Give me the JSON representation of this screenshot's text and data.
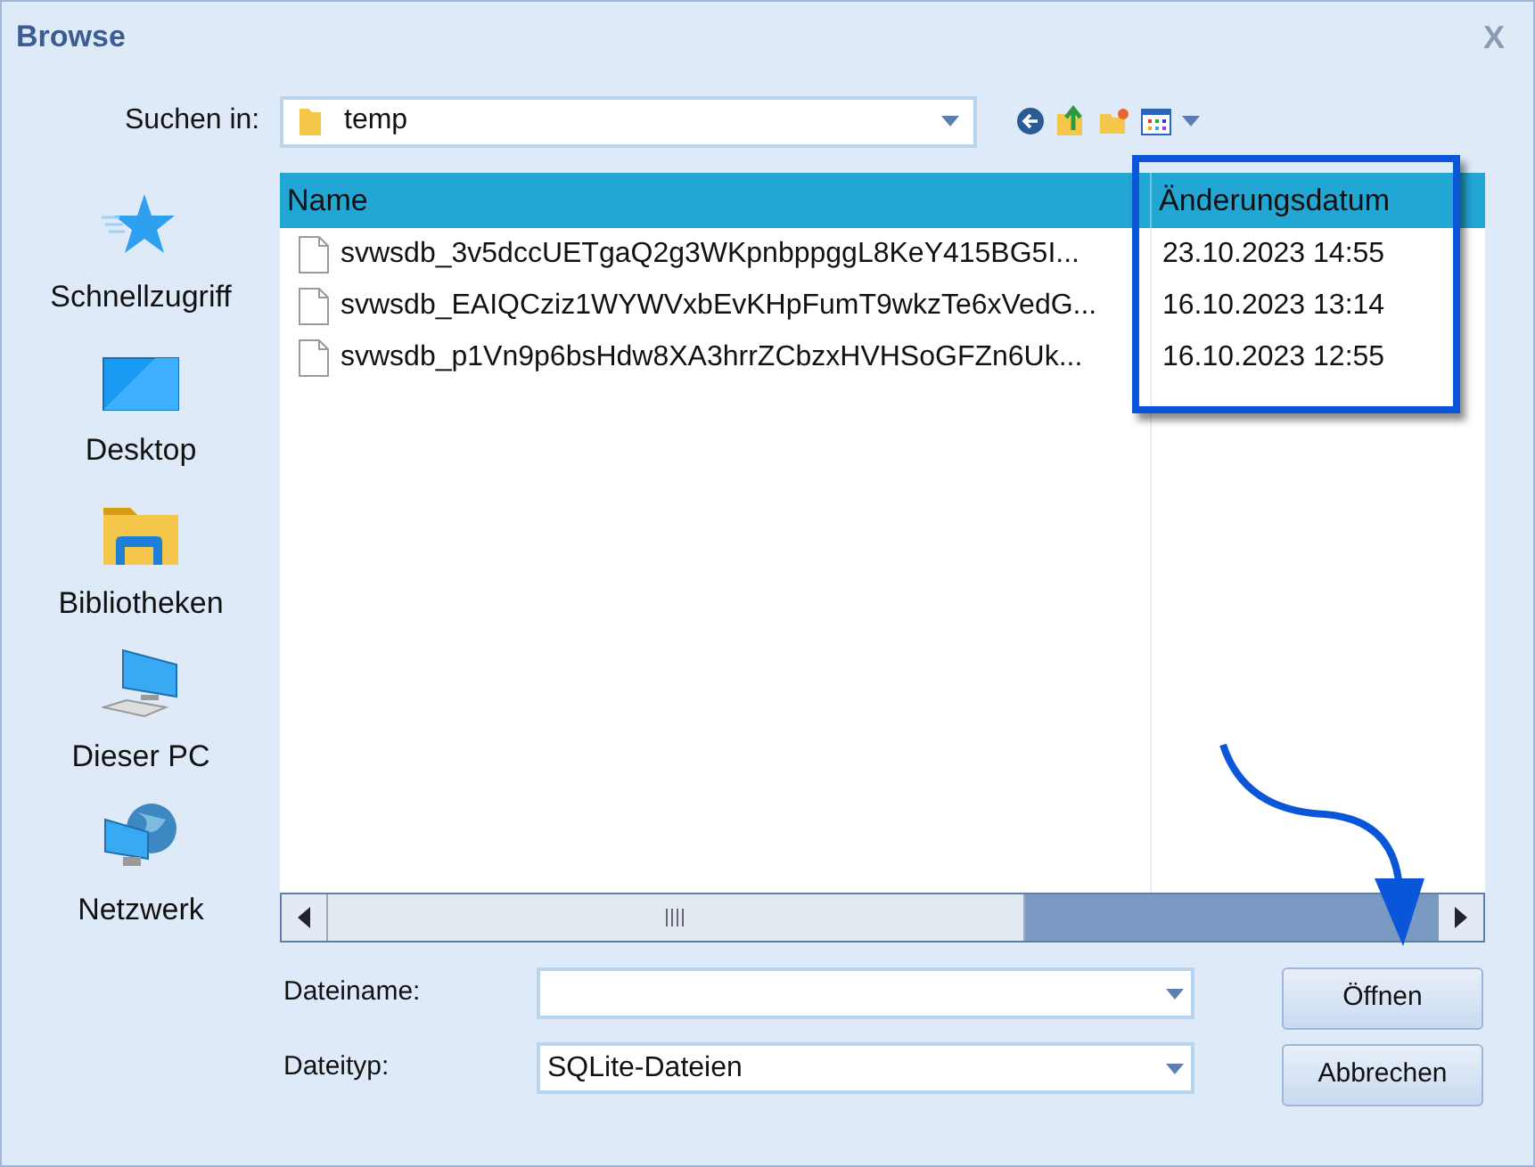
{
  "window": {
    "title": "Browse",
    "close": "X"
  },
  "look_in": {
    "label": "Suchen in:",
    "value": "temp"
  },
  "places": [
    {
      "kind": "star",
      "label": "Schnellzugriff"
    },
    {
      "kind": "desktop",
      "label": "Desktop"
    },
    {
      "kind": "library",
      "label": "Bibliotheken"
    },
    {
      "kind": "pc",
      "label": "Dieser PC"
    },
    {
      "kind": "network",
      "label": "Netzwerk"
    }
  ],
  "table": {
    "columns": [
      "Name",
      "Änderungsdatum"
    ],
    "rows": [
      {
        "name": "svwsdb_3v5dccUETgaQ2g3WKpnbppggL8KeY415BG5I...",
        "date": "23.10.2023 14:55"
      },
      {
        "name": "svwsdb_EAIQCziz1WYWVxbEvKHpFumT9wkzTe6xVedG...",
        "date": "16.10.2023 13:14"
      },
      {
        "name": "svwsdb_p1Vn9p6bsHdw8XA3hrrZCbzxHVHSoGFZn6Uk...",
        "date": "16.10.2023 12:55"
      }
    ]
  },
  "file_name": {
    "label": "Dateiname:"
  },
  "file_type": {
    "label": "Dateityp:",
    "value": "SQLite-Dateien"
  },
  "buttons": [
    "Öffnen",
    "Abbrechen"
  ]
}
